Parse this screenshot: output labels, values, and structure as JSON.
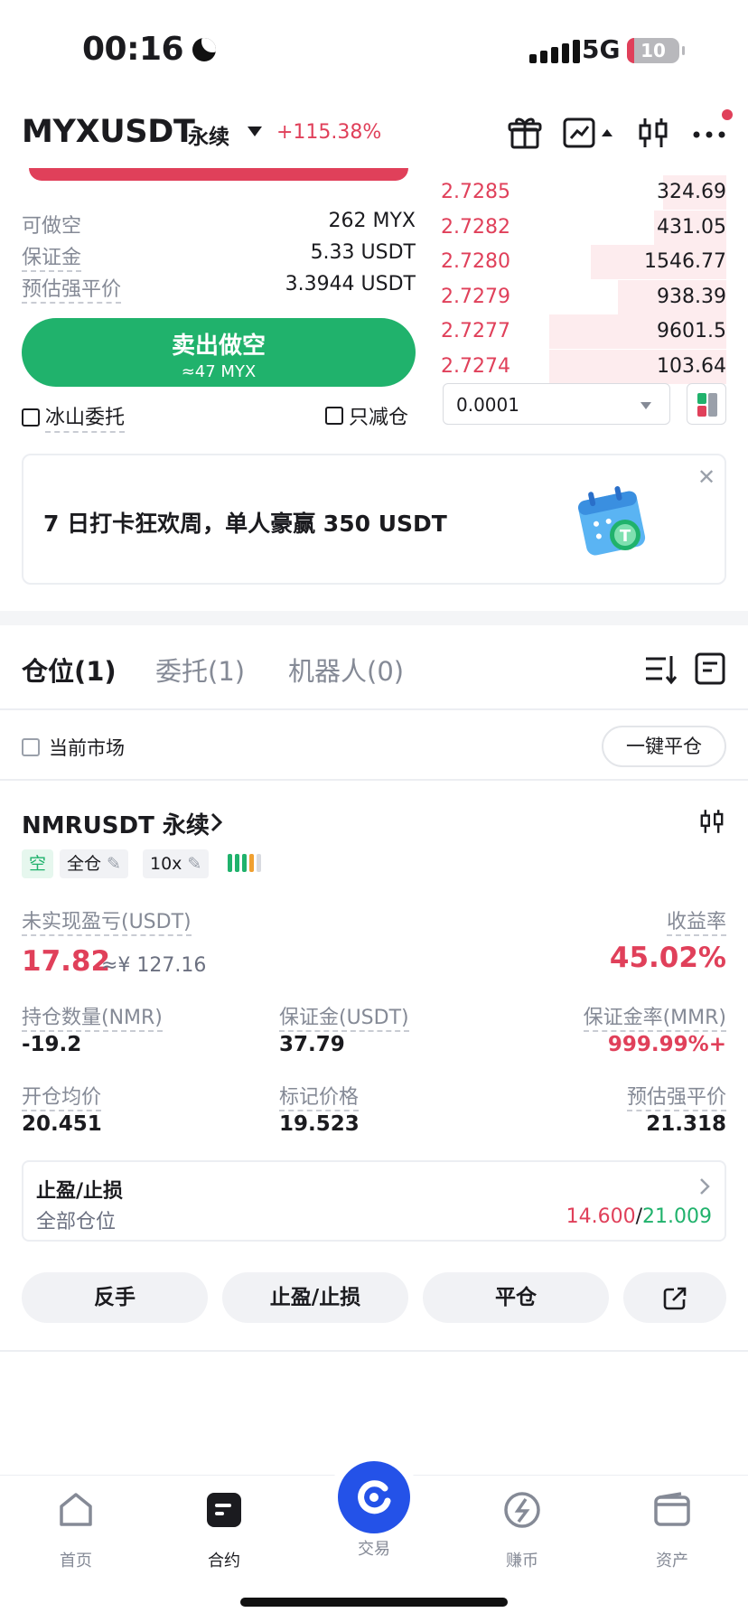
{
  "status_bar": {
    "time": "00:16",
    "network": "5G",
    "battery": "10"
  },
  "header": {
    "pair": "MYXUSDT",
    "contract_type": "永续",
    "change": "+115.38%"
  },
  "order_form": {
    "rows": [
      {
        "label": "可做空",
        "value": "262 MYX"
      },
      {
        "label": "保证金",
        "value": "5.33 USDT"
      },
      {
        "label": "预估强平价",
        "value": "3.3944 USDT"
      }
    ],
    "sell_label": "卖出做空",
    "sell_sub": "≈47 MYX",
    "iceberg_label": "冰山委托",
    "reduce_only_label": "只减仓"
  },
  "order_book": {
    "asks": [
      {
        "price": "2.7285",
        "qty": "324.69",
        "depth": 0.35
      },
      {
        "price": "2.7282",
        "qty": "431.05",
        "depth": 0.4
      },
      {
        "price": "2.7280",
        "qty": "1546.77",
        "depth": 0.75
      },
      {
        "price": "2.7279",
        "qty": "938.39",
        "depth": 0.6
      },
      {
        "price": "2.7277",
        "qty": "9601.5",
        "depth": 0.98
      },
      {
        "price": "2.7274",
        "qty": "103.64",
        "depth": 0.98
      }
    ],
    "precision": "0.0001"
  },
  "banner": {
    "text": "7 日打卡狂欢周，单人豪赢 350 USDT"
  },
  "tabs": [
    "仓位(1)",
    "委托(1)",
    "机器人(0)"
  ],
  "filter": {
    "current_market_label": "当前市场",
    "close_all_label": "一键平仓"
  },
  "position": {
    "symbol": "NMRUSDT 永续",
    "side": "空",
    "margin_mode": "全仓",
    "leverage": "10x",
    "pnl_label": "未实现盈亏(USDT)",
    "pnl_value": "17.82",
    "pnl_cny": "≈¥ 127.16",
    "roe_label": "收益率",
    "roe_value": "45.02%",
    "stats": [
      {
        "label": "持仓数量(NMR)",
        "value": "-19.2"
      },
      {
        "label": "保证金(USDT)",
        "value": "37.79"
      },
      {
        "label": "保证金率(MMR)",
        "value": "999.99%+"
      },
      {
        "label": "开仓均价",
        "value": "20.451"
      },
      {
        "label": "标记价格",
        "value": "19.523"
      },
      {
        "label": "预估强平价",
        "value": "21.318"
      }
    ],
    "tpsl_title": "止盈/止损",
    "tpsl_scope": "全部仓位",
    "tp_value": "14.600",
    "sl_value": "21.009",
    "actions": [
      "反手",
      "止盈/止损",
      "平仓"
    ]
  },
  "bottom_nav": [
    "首页",
    "合约",
    "交易",
    "赚币",
    "资产"
  ],
  "colors": {
    "red": "#e0405a",
    "green": "#20b26c",
    "blue": "#2452e8"
  }
}
